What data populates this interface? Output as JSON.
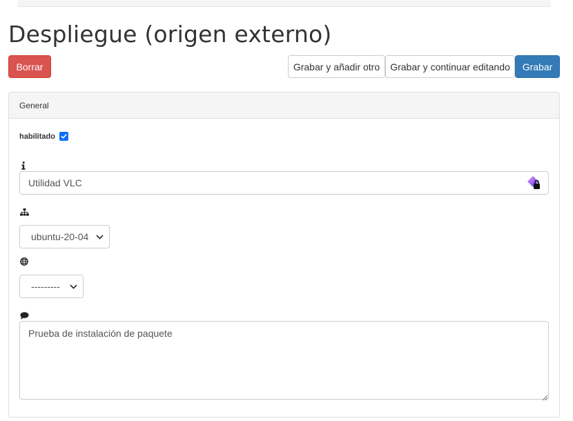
{
  "page": {
    "title": "Despliegue (origen externo)"
  },
  "actions": {
    "delete_label": "Borrar",
    "save_add_label": "Grabar y añadir otro",
    "save_continue_label": "Grabar y continuar editando",
    "save_label": "Grabar"
  },
  "panel": {
    "heading": "General",
    "enabled": {
      "label": "habilitado",
      "checked": true
    },
    "name": {
      "icon": "info-icon",
      "value": "Utilidad VLC"
    },
    "project": {
      "icon": "sitemap-icon",
      "selected": "ubuntu-20-04"
    },
    "domain": {
      "icon": "globe-icon",
      "selected": "---------"
    },
    "comment": {
      "icon": "comment-icon",
      "value": "Prueba de instalación de paquete"
    }
  },
  "colors": {
    "danger": "#d9534f",
    "primary": "#337ab7",
    "checkbox": "#0d6efd"
  }
}
